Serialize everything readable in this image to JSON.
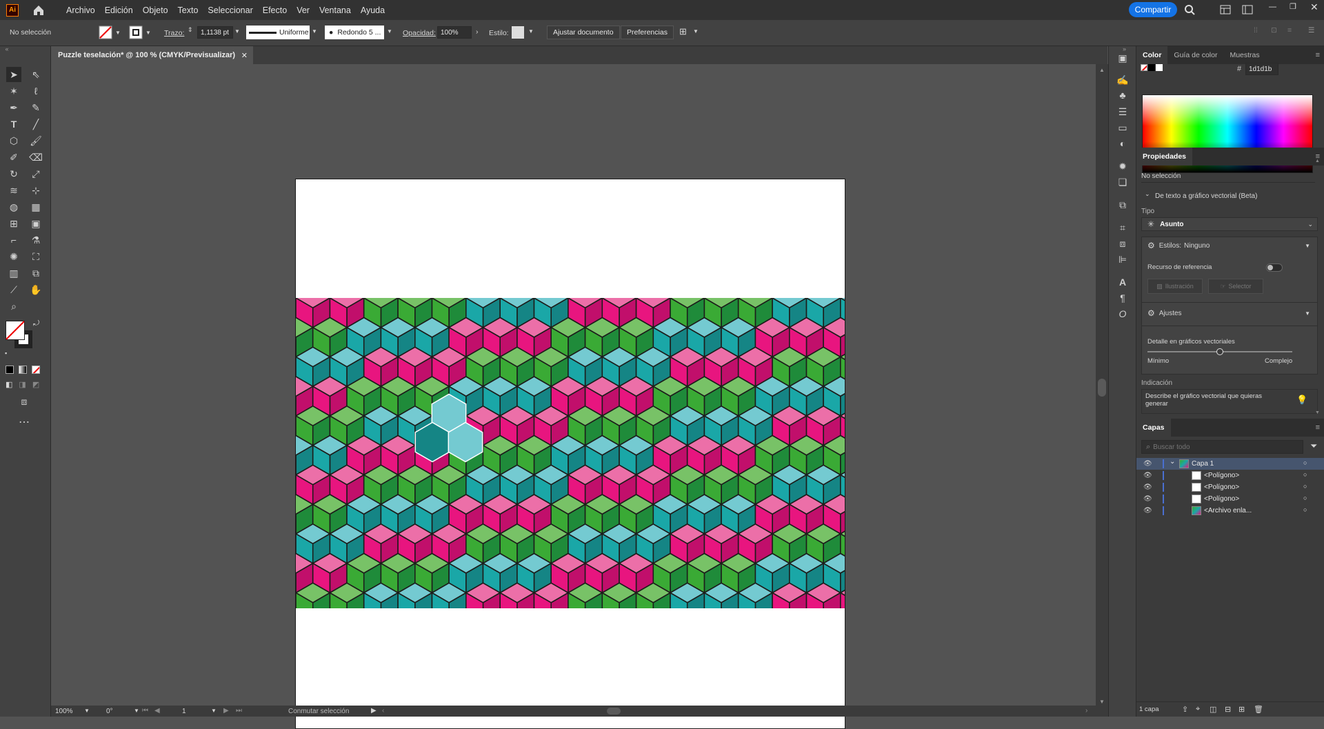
{
  "app": {
    "logo": "Ai"
  },
  "menu": [
    "Archivo",
    "Edición",
    "Objeto",
    "Texto",
    "Seleccionar",
    "Efecto",
    "Ver",
    "Ventana",
    "Ayuda"
  ],
  "share_label": "Compartir",
  "control": {
    "selection": "No selección",
    "stroke_label": "Trazo:",
    "stroke_value": "1,1138 pt",
    "profile": "Uniforme",
    "brush": "Redondo 5 ...",
    "opacity_label": "Opacidad:",
    "opacity_value": "100%",
    "style_label": "Estilo:",
    "fit_doc": "Ajustar documento",
    "prefs": "Preferencias"
  },
  "document": {
    "tab": "Puzzle teselación* @ 100 % (CMYK/Previsualizar)"
  },
  "status": {
    "zoom": "100%",
    "rotation": "0°",
    "artboard": "1",
    "toggle": "Conmutar selección"
  },
  "color_panel": {
    "tabs": [
      "Color",
      "Guía de color",
      "Muestras"
    ],
    "hex_symbol": "#",
    "hex": "1d1d1b"
  },
  "properties": {
    "title": "Propiedades",
    "selection": "No selección",
    "section": "De texto a gráfico vectorial (Beta)",
    "type_label": "Tipo",
    "type_value": "Asunto",
    "styles_label": "Estilos:",
    "styles_value": "Ninguno",
    "reference_label": "Recurso de referencia",
    "illustration": "Ilustración",
    "selector": "Selector",
    "adjust_label": "Ajustes",
    "detail_label": "Detalle en gráficos vectoriales",
    "min_label": "Mínimo",
    "max_label": "Complejo",
    "detail_level": 0.5,
    "prompt_label": "Indicación",
    "prompt_placeholder": "Describe el gráfico vectorial que quieras generar"
  },
  "layers": {
    "title": "Capas",
    "search_placeholder": "Buscar todo",
    "rows": [
      {
        "name": "Capa 1"
      },
      {
        "name": "<Polígono>"
      },
      {
        "name": "<Polígono>"
      },
      {
        "name": "<Polígono>"
      },
      {
        "name": "<Archivo enla..."
      }
    ],
    "count": "1 capa"
  },
  "colors": {
    "accent": "#1473e6",
    "pink": "#e8157f",
    "green": "#3aaa35",
    "teal": "#1aa7a7"
  }
}
